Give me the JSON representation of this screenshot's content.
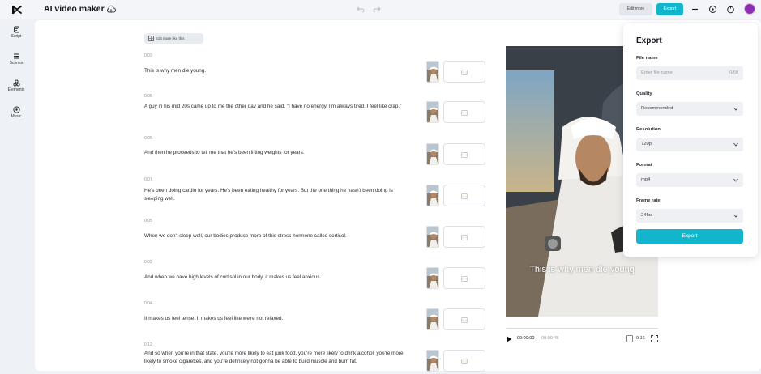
{
  "app": {
    "title": "AI video maker"
  },
  "toolbar": {
    "edit_more_label": "Edit more",
    "export_label": "Export"
  },
  "sidebar": {
    "items": [
      {
        "label": "Script",
        "icon": "script-icon"
      },
      {
        "label": "Scenes",
        "icon": "scenes-icon"
      },
      {
        "label": "Elements",
        "icon": "elements-icon"
      },
      {
        "label": "Music",
        "icon": "music-icon"
      }
    ]
  },
  "script": {
    "tag_label": "Edit more like this",
    "rows": [
      {
        "time": "0:03",
        "text": "This is why men die young."
      },
      {
        "time": "0:05",
        "text": "A guy in his mid 20s came up to me the other day and he said, \"I have no energy. I'm always tired. I feel like crap.\""
      },
      {
        "time": "0:05",
        "text": "And then he proceeds to tell me that he's been lifting weights for years."
      },
      {
        "time": "0:07",
        "text": "He's been doing cardio for years. He's been eating healthy for years. But the one thing he hasn't been doing is sleeping well."
      },
      {
        "time": "0:05",
        "text": "When we don't sleep well, our bodies produce more of this stress hormone called cortisol."
      },
      {
        "time": "0:03",
        "text": "And when we have high levels of cortisol in our body, it makes us feel anxious."
      },
      {
        "time": "0:04",
        "text": "It makes us feel tense. It makes us feel like we're not relaxed."
      },
      {
        "time": "0:12",
        "text": "And so when you're in that state, you're more likely to eat junk food, you're more likely to drink alcohol, you're more likely to smoke cigarettes, and you're definitely not gonna be able to build muscle and burn fat."
      }
    ]
  },
  "preview": {
    "caption": "This is why men die young",
    "current_time": "00:00:00",
    "total_time": "00:00:45",
    "progress": 0,
    "ratio": "9:16"
  },
  "export_panel": {
    "title": "Export",
    "file_name_label": "File name",
    "file_name_placeholder": "Enter file name",
    "file_name_count": "0/50",
    "quality_label": "Quality",
    "quality_value": "Recommended",
    "resolution_label": "Resolution",
    "resolution_value": "720p",
    "format_label": "Format",
    "format_value": "mp4",
    "frame_rate_label": "Frame rate",
    "frame_rate_value": "24fps",
    "export_button": "Export"
  },
  "colors": {
    "accent": "#12b5cb",
    "avatar": "#8e2fb3"
  }
}
